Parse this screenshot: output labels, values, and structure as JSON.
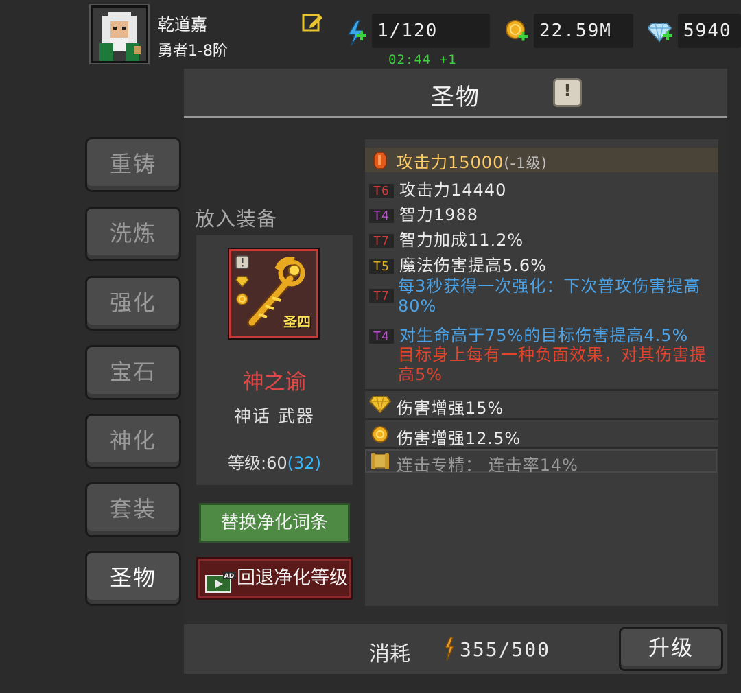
{
  "player": {
    "name": "乾道嘉",
    "rank": "勇者1-8阶"
  },
  "resources": {
    "energy": "1/120",
    "energy_timer": "02:44 +1",
    "gold": "22.59M",
    "diamonds": "5940"
  },
  "panel": {
    "title": "圣物"
  },
  "side_tabs": [
    "重铸",
    "洗炼",
    "强化",
    "宝石",
    "神化",
    "套装",
    "圣物"
  ],
  "active_tab": "圣物",
  "item": {
    "put_label": "放入装备",
    "badge": "圣四",
    "name": "神之谕",
    "type": "神话 武器",
    "level_label": "等级:60",
    "level_bonus": "(32)"
  },
  "buttons": {
    "replace": "替换净化词条",
    "revert": "回退净化等级"
  },
  "stats": {
    "main": {
      "text": "攻击力15000",
      "extra": "(-1级)"
    },
    "affixes": [
      {
        "tier": "T6",
        "text": "攻击力14440"
      },
      {
        "tier": "T4",
        "text": "智力1988"
      },
      {
        "tier": "T7",
        "text": "智力加成11.2%"
      },
      {
        "tier": "T5",
        "text": "魔法伤害提高5.6%"
      },
      {
        "tier": "T7",
        "text": "每3秒获得一次强化：下次普攻伤害提高80%"
      },
      {
        "tier": "T4",
        "text": "对生命高于75%的目标伤害提高4.5%"
      }
    ],
    "special": "目标身上每有一种负面效果，对其伤害提高5%",
    "gem_bonus": "伤害增强15%",
    "coin_bonus": "伤害增强12.5%",
    "locked_bonus": "连击专精：  连击率14%"
  },
  "footer": {
    "cost_label": "消耗",
    "cost_value": "355/500",
    "upgrade": "升级"
  },
  "colors": {
    "tier_T4": "#c04cd8",
    "tier_T5": "#e0b020",
    "tier_T6": "#d23a3a",
    "tier_T7": "#d23a3a",
    "blue_text": "#4aa3e8",
    "red_text": "#e0452c",
    "item_name": "#e14848",
    "timer": "#3bd23b"
  }
}
